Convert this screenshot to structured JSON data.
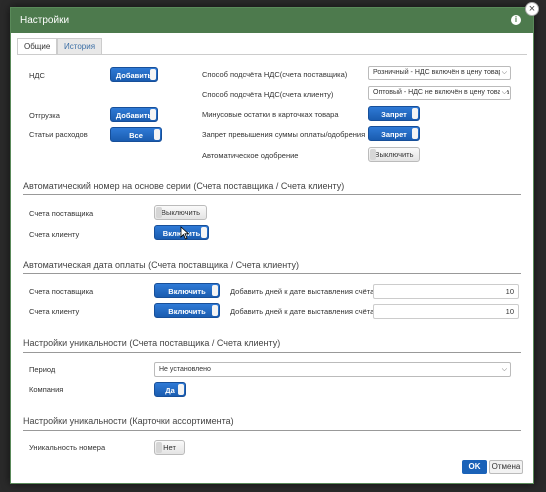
{
  "dialog": {
    "title": "Настройки",
    "tabs": [
      {
        "label": "Общие",
        "active": true
      },
      {
        "label": "История",
        "active": false
      }
    ]
  },
  "general": {
    "nds_label": "НДС",
    "nds_button": "Добавить",
    "shipment_label": "Отгрузка",
    "shipment_button": "Добавить",
    "expenses_label": "Статьи расходов",
    "expenses_button": "Все",
    "vat_supplier_label": "Способ подсчёта НДС(счета поставщика)",
    "vat_supplier_value": "Розничный - НДС включён в цену товара",
    "vat_client_label": "Способ подсчёта НДС(счета клиенту)",
    "vat_client_value": "Оптовый - НДС не включён в цену товара",
    "negative_stock_label": "Минусовые остатки в карточках товара",
    "negative_stock_button": "Запрет",
    "payment_exceed_label": "Запрет превышения суммы оплаты/одобрения",
    "payment_exceed_button": "Запрет",
    "auto_approve_label": "Автоматическое одобрение",
    "auto_approve_button": "Выключить"
  },
  "autonumber": {
    "title": "Автоматический номер на основе серии (Счета поставщика / Счета клиенту)",
    "supplier_label": "Счета поставщика",
    "supplier_button": "Выключить",
    "client_label": "Счета клиенту",
    "client_button": "Включить"
  },
  "autodate": {
    "title": "Автоматическая дата оплаты (Счета поставщика / Счета клиенту)",
    "supplier_label": "Счета поставщика",
    "supplier_button": "Включить",
    "supplier_days_label": "Добавить дней к дате выставления счёта",
    "supplier_days": "10",
    "client_label": "Счета клиенту",
    "client_button": "Включить",
    "client_days_label": "Добавить дней к дате выставления счёта",
    "client_days": "10"
  },
  "uniqueness_invoices": {
    "title": "Настройки уникальности (Счета поставщика / Счета клиенту)",
    "period_label": "Период",
    "period_value": "Не установлено",
    "company_label": "Компания",
    "company_button": "Да"
  },
  "uniqueness_cards": {
    "title": "Настройки уникальности (Карточки ассортимента)",
    "number_label": "Уникальность номера",
    "number_button": "Нет"
  },
  "footer": {
    "ok_label": "OK",
    "cancel_label": "Отмена"
  },
  "colors": {
    "titlebar": "#4d7a4d",
    "accent": "#1a5cb0"
  }
}
